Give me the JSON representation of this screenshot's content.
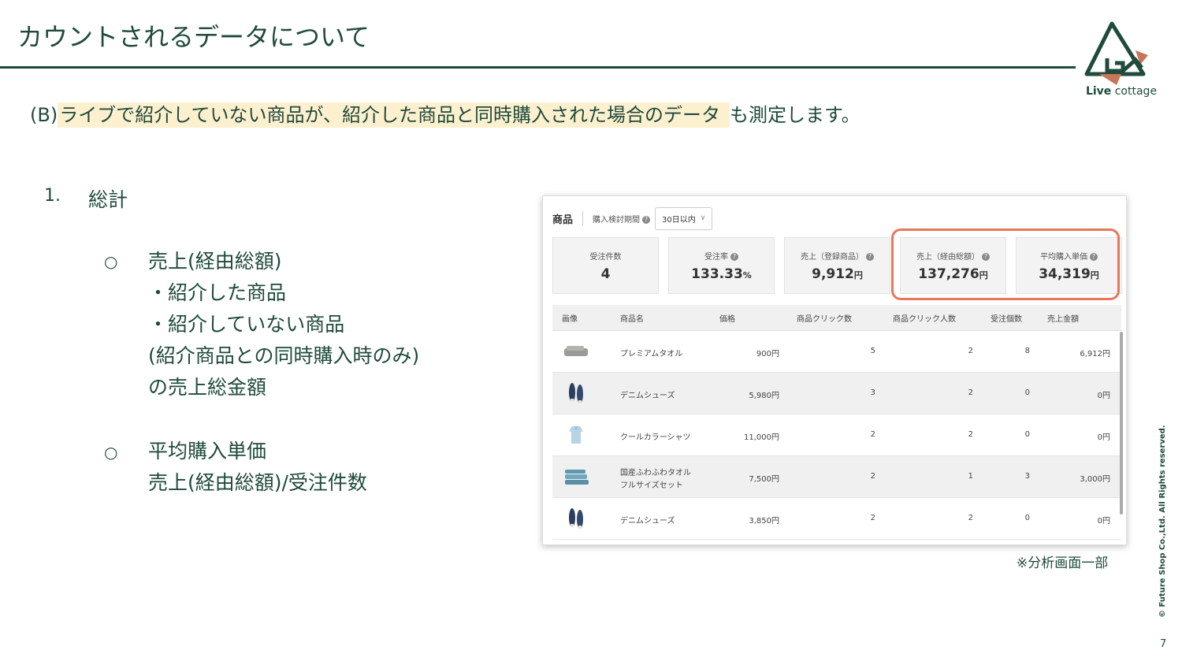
{
  "slide": {
    "title": "カウントされるデータについて",
    "subtitle_prefix": "(B)",
    "subtitle_highlight": "ライブで紹介していない商品が、紹介した商品と同時購入された場合のデータ",
    "subtitle_suffix": "も測定します。",
    "logo_text_bold": "Live",
    "logo_text": "cottage",
    "caption": "※分析画面一部",
    "copyright": "© Future Shop Co.,Ltd. All Rights reserved.",
    "page_number": "7"
  },
  "list": {
    "num": "1.",
    "heading": "総計",
    "bullet": "○",
    "item1": [
      "売上(経由総額)",
      "・紹介した商品",
      "・紹介していない商品",
      "(紹介商品との同時購入時のみ)",
      "の売上総金額"
    ],
    "item2": [
      "平均購入単価",
      "売上(経由総額)/受注件数"
    ]
  },
  "panel": {
    "title": "商品",
    "period_label": "購入検討期間",
    "period_value": "30日以内",
    "cards": [
      {
        "label": "受注件数",
        "value": "4",
        "unit": ""
      },
      {
        "label": "受注率",
        "value": "133.33",
        "unit": "%"
      },
      {
        "label": "売上（登録商品）",
        "value": "9,912",
        "unit": "円"
      },
      {
        "label": "売上（経由総額）",
        "value": "137,276",
        "unit": "円"
      },
      {
        "label": "平均購入単価",
        "value": "34,319",
        "unit": "円"
      }
    ],
    "columns": [
      "画像",
      "商品名",
      "価格",
      "商品クリック数",
      "商品クリック人数",
      "受注個数",
      "売上金額"
    ],
    "rows": [
      {
        "name": "プレミアムタオル",
        "name2": "",
        "price": "900円",
        "clicks": "5",
        "users": "2",
        "orders": "8",
        "sales": "6,912円",
        "icon": "towel-icon"
      },
      {
        "name": "デニムシューズ",
        "name2": "",
        "price": "5,980円",
        "clicks": "3",
        "users": "2",
        "orders": "0",
        "sales": "0円",
        "icon": "shoes-icon"
      },
      {
        "name": "クールカラーシャツ",
        "name2": "",
        "price": "11,000円",
        "clicks": "2",
        "users": "2",
        "orders": "0",
        "sales": "0円",
        "icon": "shirt-icon"
      },
      {
        "name": "国産ふわふわタオル",
        "name2": "フルサイズセット",
        "price": "7,500円",
        "clicks": "2",
        "users": "1",
        "orders": "3",
        "sales": "3,000円",
        "icon": "towel-set-icon"
      },
      {
        "name": "デニムシューズ",
        "name2": "",
        "price": "3,850円",
        "clicks": "2",
        "users": "2",
        "orders": "0",
        "sales": "0円",
        "icon": "shoes-icon"
      }
    ]
  },
  "colors": {
    "text": "#1f4a3c",
    "highlight_bg": "#fdf0cf",
    "callout": "#e8775a"
  }
}
